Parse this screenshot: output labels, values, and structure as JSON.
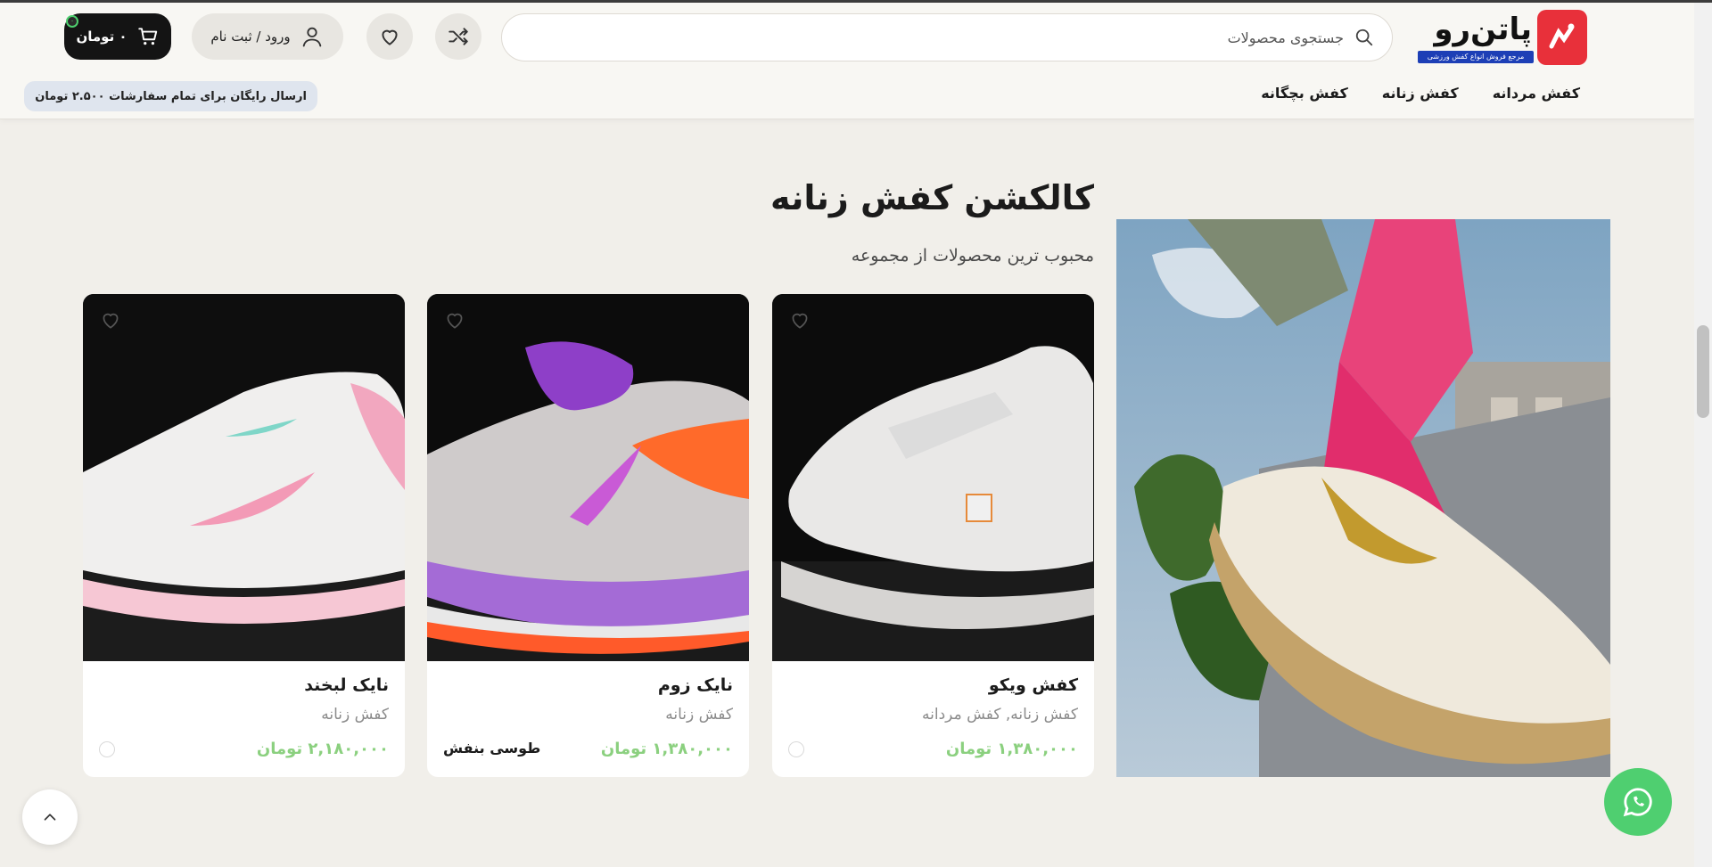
{
  "header": {
    "logo_name": "پاتن‌رو",
    "logo_tagline": "مرجع فروش انواع کفش ورزشی",
    "search_placeholder": "جستجوی محصولات",
    "login_label": "ورود / ثبت نام",
    "cart_label": "۰ تومان",
    "cart_count": "۰",
    "shipping_badge": "ارسال رایگان برای تمام سفارشات ۲.۵۰۰ تومان"
  },
  "nav": {
    "items": [
      {
        "label": "کفش مردانه"
      },
      {
        "label": "کفش زنانه"
      },
      {
        "label": "کفش بچگانه"
      }
    ]
  },
  "section": {
    "title": "کالکشن کفش زنانه",
    "subtitle": "محبوب ترین محصولات از مجموعه"
  },
  "products": [
    {
      "title": "کفش ویکو",
      "category": "کفش زنانه, کفش مردانه",
      "price": "۱,۳۸۰,۰۰۰ تومان"
    },
    {
      "title": "نایک زوم",
      "category": "کفش زنانه",
      "price": "۱,۳۸۰,۰۰۰ تومان",
      "color": "طوسی بنفش"
    },
    {
      "title": "نایک لبخند",
      "category": "کفش زنانه",
      "price": "۲,۱۸۰,۰۰۰ تومان"
    }
  ],
  "colors": {
    "accent_green": "#8bd07f",
    "logo_red": "#e8303a",
    "whatsapp": "#4fcf70",
    "cart_bg": "#141414"
  },
  "icons": [
    "search-icon",
    "shuffle-icon",
    "heart-icon",
    "user-icon",
    "cart-icon",
    "chevron-up-icon",
    "whatsapp-icon"
  ]
}
